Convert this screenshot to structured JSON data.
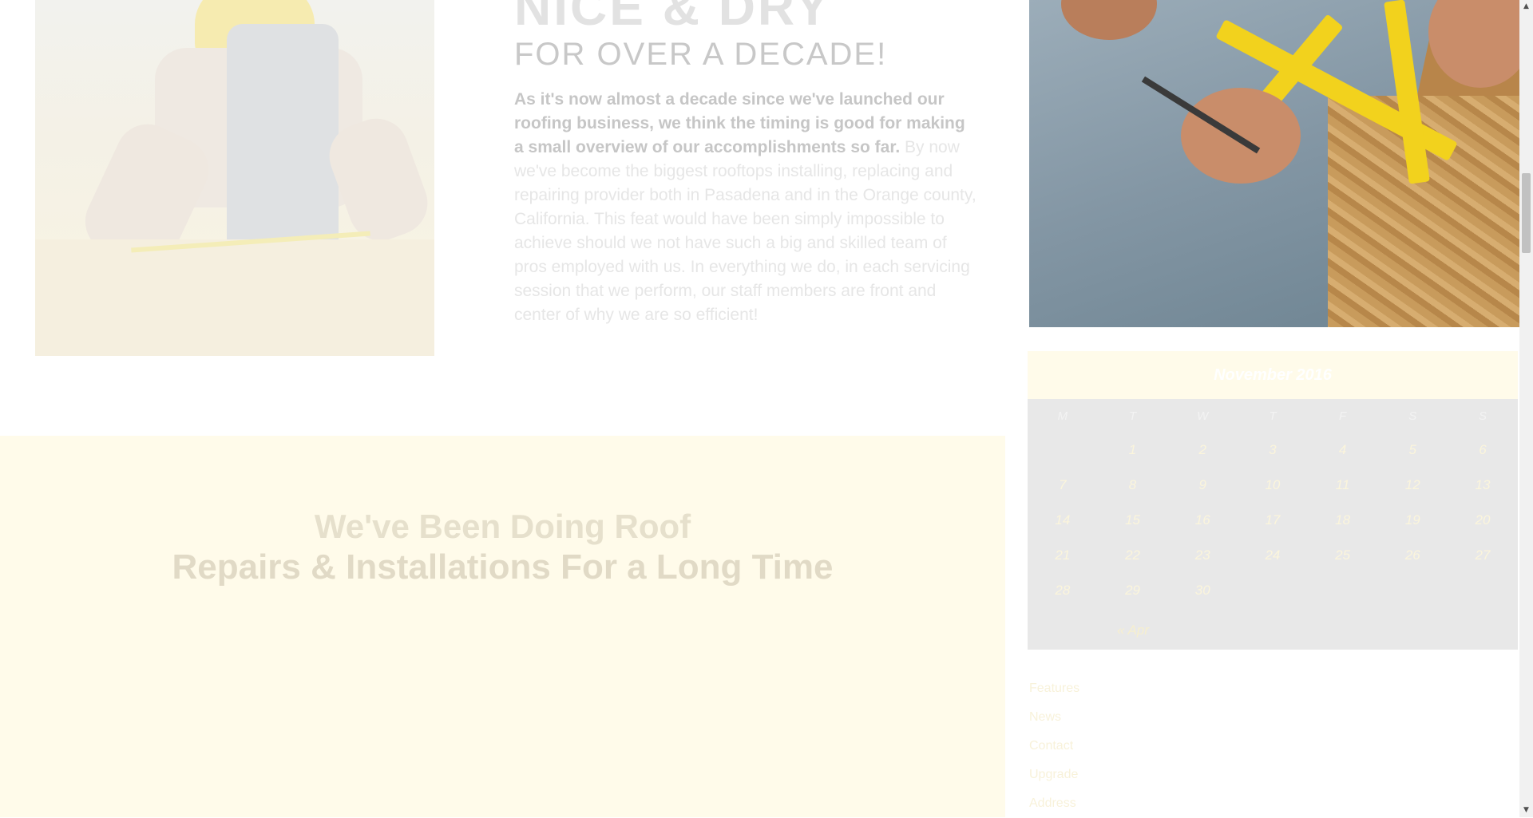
{
  "about": {
    "headline": "NICE & DRY",
    "subheadline": "FOR OVER A DECADE!",
    "intro_strong": "As it's now almost a decade since we've launched our roofing business, we think the timing is good for making a small overview of our accomplishments so far.",
    "intro_body": " By now we've become the biggest rooftops installing, replacing and repairing provider both in Pasadena and in the Orange county, California. This feat would have been simply impossible to achieve should we not have such a big and skilled team of pros employed with us. In everything we do, in each servicing session that we perform, our staff members are front and center of why we are so efficient!"
  },
  "band": {
    "title_line1": "We've Been Doing Roof",
    "title_line2": "Repairs & Installations For a Long Time"
  },
  "calendar": {
    "month_label": "November 2016",
    "weekdays": [
      "M",
      "T",
      "W",
      "T",
      "F",
      "S",
      "S"
    ],
    "weeks": [
      [
        "",
        "1",
        "2",
        "3",
        "4",
        "5",
        "6"
      ],
      [
        "7",
        "8",
        "9",
        "10",
        "11",
        "12",
        "13"
      ],
      [
        "14",
        "15",
        "16",
        "17",
        "18",
        "19",
        "20"
      ],
      [
        "21",
        "22",
        "23",
        "24",
        "25",
        "26",
        "27"
      ],
      [
        "28",
        "29",
        "30",
        "",
        "",
        "",
        ""
      ]
    ],
    "prev_link": "« Apr"
  },
  "sidebar_links": [
    "Features",
    "News",
    "Contact",
    "Upgrade",
    "Address"
  ],
  "colors": {
    "band_background": "#fffbea",
    "calendar_background": "#e8e8e8",
    "accent_yellow": "#f2d21d"
  },
  "icons": {
    "scroll_up": "triangle-up-icon",
    "scroll_down": "triangle-down-icon"
  }
}
